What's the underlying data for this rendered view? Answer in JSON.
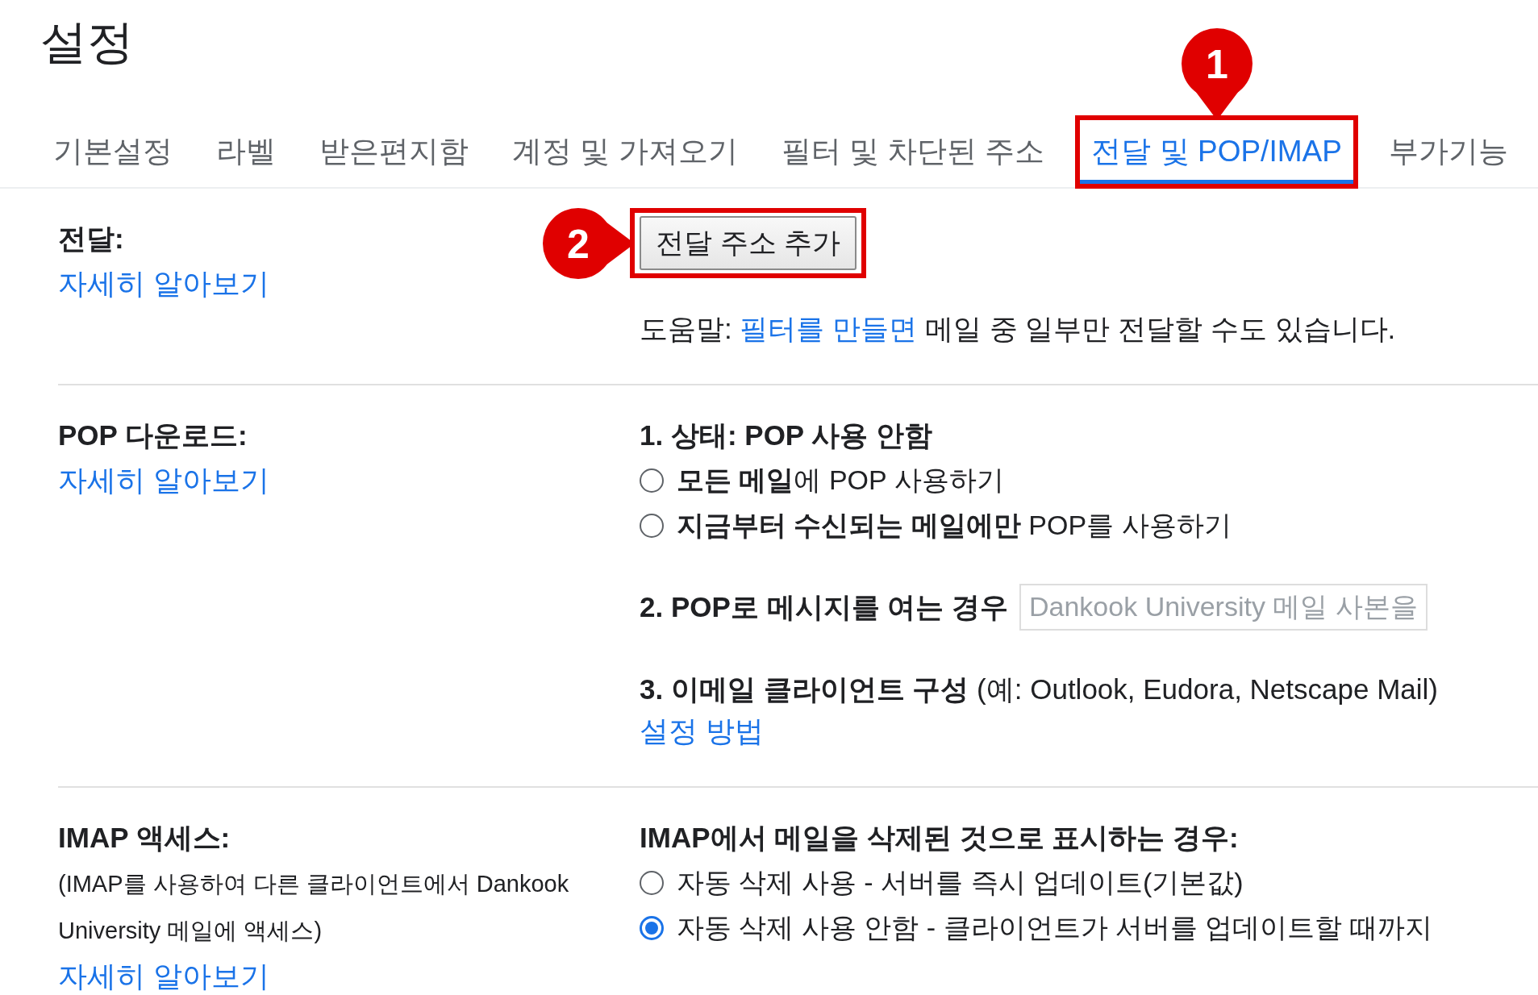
{
  "title": "설정",
  "tabs": [
    {
      "label": "기본설정",
      "selected": false
    },
    {
      "label": "라벨",
      "selected": false
    },
    {
      "label": "받은편지함",
      "selected": false
    },
    {
      "label": "계정 및 가져오기",
      "selected": false
    },
    {
      "label": "필터 및 차단된 주소",
      "selected": false
    },
    {
      "label": "전달 및 POP/IMAP",
      "selected": true,
      "marker": "1"
    },
    {
      "label": "부가기능",
      "selected": false
    }
  ],
  "forwarding": {
    "label": "전달:",
    "learn_more": "자세히 알아보기",
    "button": {
      "label": "전달 주소 추가",
      "marker": "2"
    },
    "help": {
      "prefix": "도움말:",
      "link": "필터를 만들면",
      "suffix": "메일 중 일부만 전달할 수도 있습니다."
    }
  },
  "pop": {
    "label": "POP 다운로드:",
    "learn_more": "자세히 알아보기",
    "status": "1. 상태: POP 사용 안함",
    "options": [
      {
        "label": "**모든 메일**에 POP 사용하기",
        "selected": false
      },
      {
        "label": "**지금부터 수신되는 메일에만** POP를 사용하기",
        "selected": false
      }
    ],
    "when_opened": {
      "label": "2. POP로 메시지를 여는 경우",
      "value": "Dankook University 메일 사본을",
      "disabled": true
    },
    "client": {
      "text": "**3. 이메일 클라이언트 구성** (예: Outlook, Eudora, Netscape Mail)",
      "link": "설정 방법"
    }
  },
  "imap": {
    "label": "IMAP 액세스:",
    "description": "(IMAP를 사용하여 다른 클라이언트에서 Dankook University 메일에 액세스)",
    "learn_more": "자세히 알아보기",
    "heading": "IMAP에서 메일을 삭제된 것으로 표시하는 경우:",
    "options": [
      {
        "label": "자동 삭제 사용 - 서버를 즉시 업데이트(기본값)",
        "selected": false
      },
      {
        "label": "자동 삭제 사용 안함 - 클라이언트가 서버를 업데이트할 때까지",
        "selected": true
      }
    ]
  }
}
